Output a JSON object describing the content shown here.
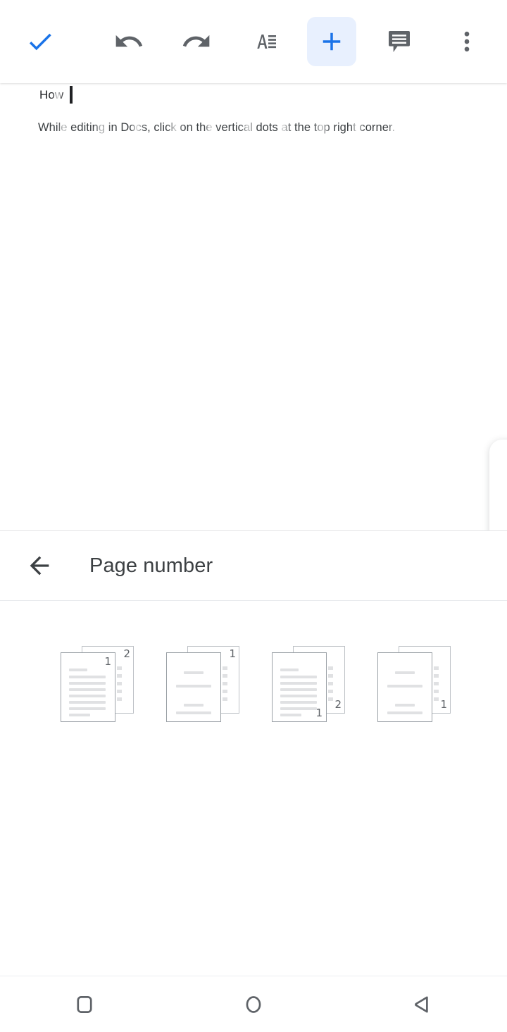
{
  "toolbar": {
    "accept": {
      "label": "Accept",
      "icon": "check-icon",
      "color": "#1a73e8"
    },
    "undo": {
      "label": "Undo",
      "icon": "undo-icon"
    },
    "redo": {
      "label": "Redo",
      "icon": "redo-icon"
    },
    "format": {
      "label": "Format",
      "icon": "format-text-icon"
    },
    "insert": {
      "label": "Insert",
      "icon": "plus-icon",
      "active": true,
      "active_bg": "#e8f0fe",
      "color": "#1a73e8"
    },
    "comment": {
      "label": "Comment",
      "icon": "comment-icon"
    },
    "more": {
      "label": "More options",
      "icon": "more-vert-icon"
    },
    "icon_color": "#5f6368"
  },
  "document": {
    "title": "How",
    "body": "While editing in Docs, click on the vertical dots at the top right corner.",
    "cursor_visible": true
  },
  "panel": {
    "back": {
      "label": "Back",
      "icon": "arrow-back-icon"
    },
    "title": "Page number",
    "options": [
      {
        "name": "top-right-all-pages",
        "label": "Page number at top right of every page",
        "position": "top-right",
        "number_first_page": "1",
        "number_second_page": "2",
        "first_page_numbered": true,
        "dense_text": true
      },
      {
        "name": "top-right-skip-first",
        "label": "Page number at top right, skip first page",
        "position": "top-right",
        "number_first_page": "",
        "number_second_page": "1",
        "first_page_numbered": false,
        "dense_text": false
      },
      {
        "name": "bottom-right-all-pages",
        "label": "Page number at bottom right of every page",
        "position": "bottom-right",
        "number_first_page": "1",
        "number_second_page": "2",
        "first_page_numbered": true,
        "dense_text": true
      },
      {
        "name": "bottom-right-skip-first",
        "label": "Page number at bottom right, skip first page",
        "position": "bottom-right",
        "number_first_page": "",
        "number_second_page": "1",
        "first_page_numbered": false,
        "dense_text": false
      }
    ]
  },
  "navbar": {
    "recents": {
      "label": "Recent apps",
      "icon": "square-icon"
    },
    "home": {
      "label": "Home",
      "icon": "circle-icon"
    },
    "back": {
      "label": "Back",
      "icon": "triangle-back-icon"
    }
  }
}
